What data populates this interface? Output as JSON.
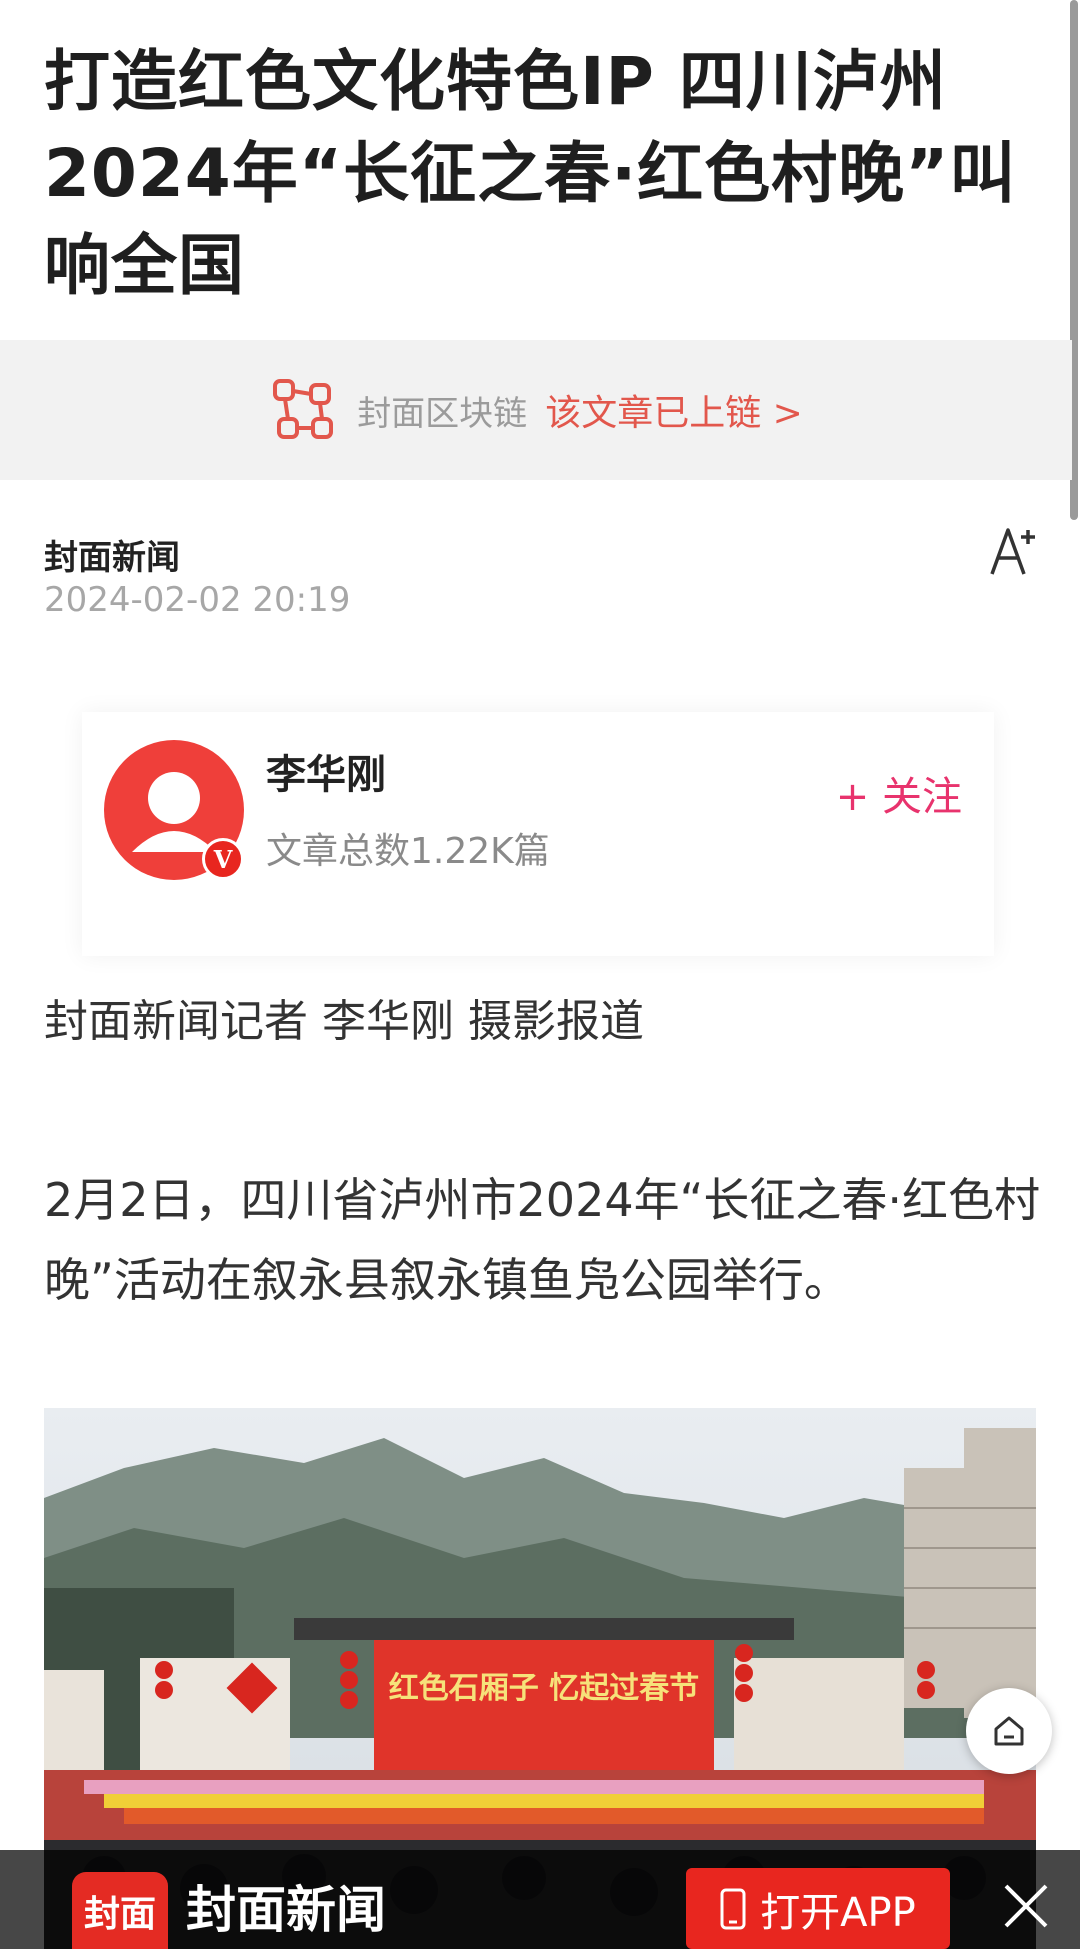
{
  "article": {
    "title": "打造红色文化特色IP 四川泸州2024年“长征之春·红色村晚”叫响全国",
    "blockchain": {
      "label": "封面区块链",
      "link": "该文章已上链 >"
    },
    "source": "封面新闻",
    "datetime": "2024-02-02 20:19",
    "byline": "封面新闻记者 李华刚 摄影报道",
    "paragraph": "2月2日，四川省泸州市2024年“长征之春·红色村晚”活动在叙永县叙永镇鱼凫公园举行。"
  },
  "author": {
    "name": "李华刚",
    "article_count": "文章总数1.22K篇",
    "follow_label": "+ 关注",
    "badge": "V"
  },
  "banner": {
    "logo_text": "封面",
    "app_name": "封面新闻",
    "open_app_label": "打开APP"
  },
  "colors": {
    "accent_red": "#e8261f",
    "link_red": "#e2574c",
    "follow_pink": "#e8336d"
  },
  "icons": [
    "blockchain-icon",
    "font-size-icon",
    "home-icon",
    "phone-icon",
    "close-icon"
  ]
}
